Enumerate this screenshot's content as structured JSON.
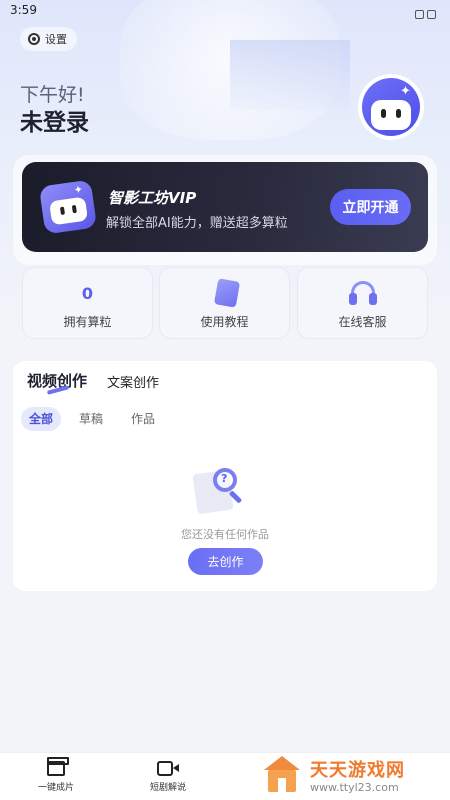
{
  "status_bar": {
    "time": "3:59"
  },
  "header": {
    "settings_label": "设置",
    "greeting": "下午好!",
    "login_state": "未登录"
  },
  "vip": {
    "title": "智影工坊VIP",
    "subtitle": "解锁全部AI能力，赠送超多算粒",
    "button": "立即开通"
  },
  "quick_actions": [
    {
      "value": "0",
      "label": "拥有算粒"
    },
    {
      "label": "使用教程"
    },
    {
      "label": "在线客服"
    }
  ],
  "works": {
    "tabs": [
      "视频创作",
      "文案创作"
    ],
    "filters": [
      "全部",
      "草稿",
      "作品"
    ],
    "empty_text": "您还没有任何作品",
    "create_button": "去创作"
  },
  "bottom_nav": [
    {
      "label": "一键成片",
      "icon": "clapperboard-icon"
    },
    {
      "label": "短剧解说",
      "icon": "video-camera-icon"
    }
  ],
  "watermark": {
    "name": "天天游戏网",
    "url": "www.ttyl23.com"
  },
  "colors": {
    "accent": "#5b5ff2",
    "vip_card": "#1b1c2a",
    "page_bg": "#f2f4f9"
  }
}
